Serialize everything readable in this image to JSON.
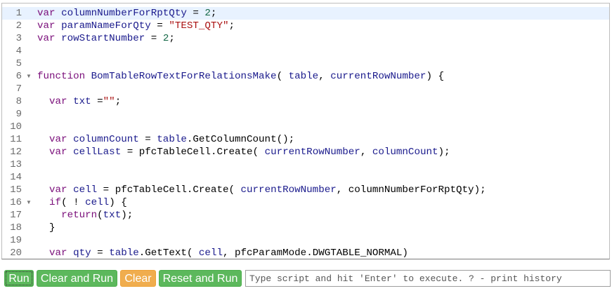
{
  "editor": {
    "active_line": 1,
    "lines": [
      {
        "n": "1",
        "fold": false,
        "tokens": [
          [
            "kw",
            "var"
          ],
          [
            "t",
            " "
          ],
          [
            "vr",
            "columnNumberForRptQty"
          ],
          [
            "t",
            " = "
          ],
          [
            "num",
            "2"
          ],
          [
            "t",
            ";"
          ]
        ]
      },
      {
        "n": "2",
        "fold": false,
        "tokens": [
          [
            "kw",
            "var"
          ],
          [
            "t",
            " "
          ],
          [
            "vr",
            "paramNameForQty"
          ],
          [
            "t",
            " = "
          ],
          [
            "str",
            "\"TEST_QTY\""
          ],
          [
            "t",
            ";"
          ]
        ]
      },
      {
        "n": "3",
        "fold": false,
        "tokens": [
          [
            "kw",
            "var"
          ],
          [
            "t",
            " "
          ],
          [
            "vr",
            "rowStartNumber"
          ],
          [
            "t",
            " = "
          ],
          [
            "num",
            "2"
          ],
          [
            "t",
            ";"
          ]
        ]
      },
      {
        "n": "4",
        "fold": false,
        "tokens": []
      },
      {
        "n": "5",
        "fold": false,
        "tokens": []
      },
      {
        "n": "6",
        "fold": true,
        "tokens": [
          [
            "kw",
            "function"
          ],
          [
            "t",
            " "
          ],
          [
            "def",
            "BomTableRowTextForRelationsMake"
          ],
          [
            "t",
            "( "
          ],
          [
            "def",
            "table"
          ],
          [
            "t",
            ", "
          ],
          [
            "def",
            "currentRowNumber"
          ],
          [
            "t",
            ") {"
          ]
        ]
      },
      {
        "n": "7",
        "fold": false,
        "tokens": []
      },
      {
        "n": "8",
        "fold": false,
        "tokens": [
          [
            "t",
            "  "
          ],
          [
            "kw",
            "var"
          ],
          [
            "t",
            " "
          ],
          [
            "def",
            "txt"
          ],
          [
            "t",
            " ="
          ],
          [
            "str",
            "\"\""
          ],
          [
            "t",
            ";"
          ]
        ]
      },
      {
        "n": "9",
        "fold": false,
        "tokens": []
      },
      {
        "n": "10",
        "fold": false,
        "tokens": []
      },
      {
        "n": "11",
        "fold": false,
        "tokens": [
          [
            "t",
            "  "
          ],
          [
            "kw",
            "var"
          ],
          [
            "t",
            " "
          ],
          [
            "def",
            "columnCount"
          ],
          [
            "t",
            " = "
          ],
          [
            "def",
            "table"
          ],
          [
            "t",
            "."
          ],
          [
            "prop",
            "GetColumnCount"
          ],
          [
            "t",
            "();"
          ]
        ]
      },
      {
        "n": "12",
        "fold": false,
        "tokens": [
          [
            "t",
            "  "
          ],
          [
            "kw",
            "var"
          ],
          [
            "t",
            " "
          ],
          [
            "def",
            "cellLast"
          ],
          [
            "t",
            " = "
          ],
          [
            "prop",
            "pfcTableCell"
          ],
          [
            "t",
            "."
          ],
          [
            "prop",
            "Create"
          ],
          [
            "t",
            "( "
          ],
          [
            "def",
            "currentRowNumber"
          ],
          [
            "t",
            ", "
          ],
          [
            "def",
            "columnCount"
          ],
          [
            "t",
            ");"
          ]
        ]
      },
      {
        "n": "13",
        "fold": false,
        "tokens": []
      },
      {
        "n": "14",
        "fold": false,
        "tokens": []
      },
      {
        "n": "15",
        "fold": false,
        "tokens": [
          [
            "t",
            "  "
          ],
          [
            "kw",
            "var"
          ],
          [
            "t",
            " "
          ],
          [
            "def",
            "cell"
          ],
          [
            "t",
            " = "
          ],
          [
            "prop",
            "pfcTableCell"
          ],
          [
            "t",
            "."
          ],
          [
            "prop",
            "Create"
          ],
          [
            "t",
            "( "
          ],
          [
            "def",
            "currentRowNumber"
          ],
          [
            "t",
            ", "
          ],
          [
            "prop",
            "columnNumberForRptQty"
          ],
          [
            "t",
            ");"
          ]
        ]
      },
      {
        "n": "16",
        "fold": true,
        "tokens": [
          [
            "t",
            "  "
          ],
          [
            "kw",
            "if"
          ],
          [
            "t",
            "( ! "
          ],
          [
            "def",
            "cell"
          ],
          [
            "t",
            ") {"
          ]
        ]
      },
      {
        "n": "17",
        "fold": false,
        "tokens": [
          [
            "t",
            "    "
          ],
          [
            "kw",
            "return"
          ],
          [
            "t",
            "("
          ],
          [
            "def",
            "txt"
          ],
          [
            "t",
            ");"
          ]
        ]
      },
      {
        "n": "18",
        "fold": false,
        "tokens": [
          [
            "t",
            "  }"
          ]
        ]
      },
      {
        "n": "19",
        "fold": false,
        "tokens": []
      },
      {
        "n": "20",
        "fold": false,
        "tokens": [
          [
            "t",
            "  "
          ],
          [
            "kw",
            "var"
          ],
          [
            "t",
            " "
          ],
          [
            "def",
            "qty"
          ],
          [
            "t",
            " = "
          ],
          [
            "def",
            "table"
          ],
          [
            "t",
            "."
          ],
          [
            "prop",
            "GetText"
          ],
          [
            "t",
            "( "
          ],
          [
            "def",
            "cell"
          ],
          [
            "t",
            ", "
          ],
          [
            "prop",
            "pfcParamMode"
          ],
          [
            "t",
            "."
          ],
          [
            "prop",
            "DWGTABLE_NORMAL"
          ],
          [
            "t",
            ")"
          ]
        ]
      }
    ],
    "fold_icon": "triangle-down-icon"
  },
  "toolbar": {
    "run_label": "Run",
    "clear_and_run_label": "Clear and Run",
    "clear_label": "Clear",
    "reset_and_run_label": "Reset and Run",
    "console_placeholder": "Type script and hit 'Enter' to execute. ? - print history",
    "console_value": ""
  },
  "colors": {
    "green_button": "#5cb85c",
    "orange_button": "#f0ad4e",
    "keyword": "#7a0e7a",
    "variable": "#1a1a8c",
    "number": "#116644",
    "string": "#aa1111"
  }
}
